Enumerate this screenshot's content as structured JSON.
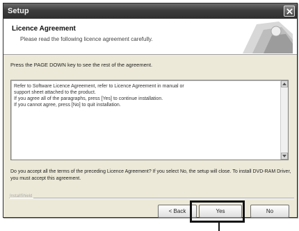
{
  "window": {
    "title": "Setup",
    "close_icon": "close-icon"
  },
  "header": {
    "title": "Licence Agreement",
    "subtitle": "Please read the following licence agreement carefully."
  },
  "instruction": "Press the PAGE DOWN key to see the rest of the agreement.",
  "license": {
    "lines": [
      "Refer to Software Licence Agreement, refer to Licence Agreement in manual or",
      "support sheet attached to the product.",
      "If you agree all of the paragraphs, press [Yes] to continue installation.",
      "If you cannot agree, press [No] to quit installation."
    ]
  },
  "question": "Do you accept all the terms of the preceding Licence Agreement? If you select No, the setup will close. To install DVD-RAM Driver, you must accept this agreement.",
  "brand": "InstallShield",
  "buttons": {
    "back": "< Back",
    "yes": "Yes",
    "no": "No"
  },
  "colors": {
    "titlebar": "#3c3c3c",
    "dialog_bg": "#ece9d8",
    "highlight": "#111111"
  }
}
